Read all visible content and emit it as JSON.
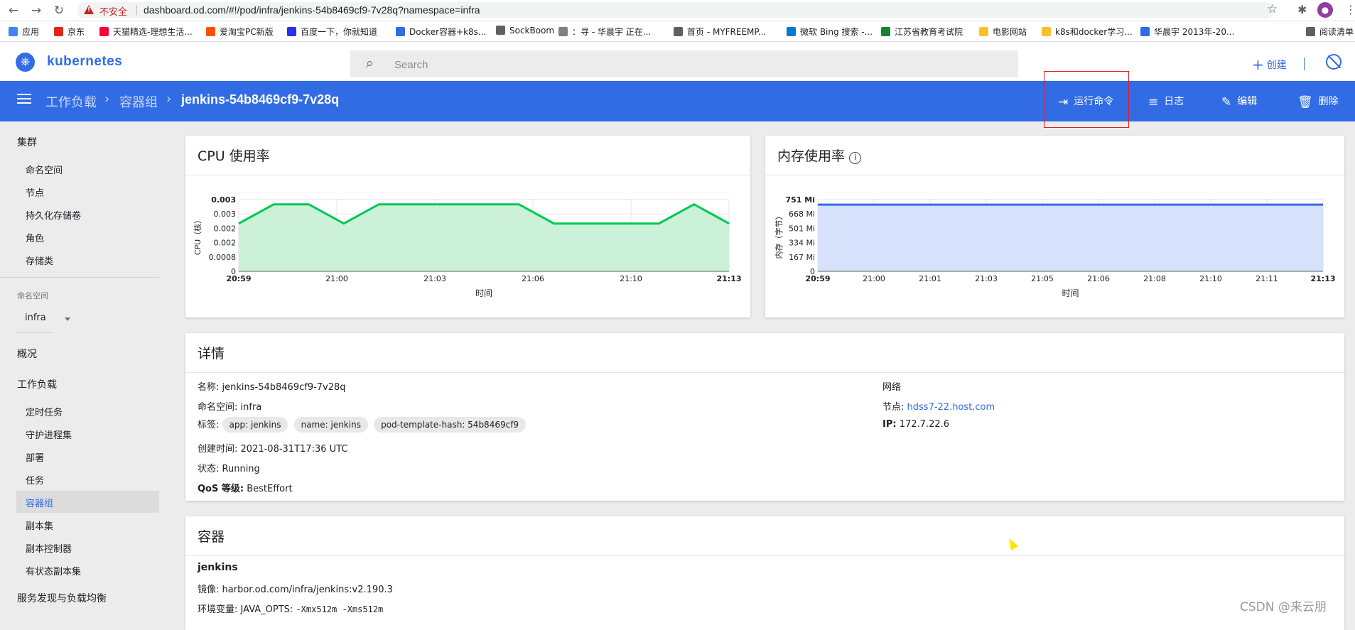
{
  "browser": {
    "insecure_label": "不安全",
    "url": "dashboard.od.com/#!/pod/infra/jenkins-54b8469cf9-7v28q?namespace=infra",
    "bookmarks": [
      "应用",
      "京东",
      "天猫精选-理想生活...",
      "爱淘宝PC新版",
      "百度一下，你就知道",
      "Docker容器+k8s...",
      "SockBoom",
      "：寻 - 华晨宇 正在...",
      "首页 - MYFREEMP...",
      "微软 Bing 搜索 -...",
      "江苏省教育考试院",
      "电影网站",
      "k8s和docker学习...",
      "华晨宇 2013年-20...",
      "阅读清单"
    ],
    "bookmark_colors": [
      "#4285f4",
      "#e1251b",
      "#ff0036",
      "#ff5000",
      "#2932e1",
      "#326ce5",
      "#606060",
      "#808080",
      "#606060",
      "#0078d4",
      "#1a7f37",
      "#fbc02d",
      "#fbc02d",
      "#326ce5",
      "#606060"
    ]
  },
  "header": {
    "brand": "kubernetes",
    "search_placeholder": "Search",
    "create_label": "创建"
  },
  "toolbar": {
    "breadcrumb": [
      "工作负载",
      "容器组"
    ],
    "current": "jenkins-54b8469cf9-7v28q",
    "actions": [
      "运行命令",
      "日志",
      "编辑",
      "删除"
    ]
  },
  "sidebar": {
    "cluster_heading": "集群",
    "cluster_items": [
      "命名空间",
      "节点",
      "持久化存储卷",
      "角色",
      "存储类"
    ],
    "namespace_label": "命名空间",
    "namespace_value": "infra",
    "overview": "概况",
    "workloads_heading": "工作负载",
    "workload_items": [
      "定时任务",
      "守护进程集",
      "部署",
      "任务",
      "容器组",
      "副本集",
      "副本控制器",
      "有状态副本集"
    ],
    "selected_item": "容器组",
    "services_heading": "服务发现与负载均衡"
  },
  "cpu_card": {
    "title": "CPU 使用率"
  },
  "memory_card": {
    "title": "内存使用率"
  },
  "chart_data": [
    {
      "type": "area",
      "title": "CPU 使用率",
      "xlabel": "时间",
      "ylabel": "CPU（核）",
      "x_ticks": [
        "20:59",
        "21:00",
        "21:03",
        "21:06",
        "21:10",
        "21:13"
      ],
      "y_ticks": [
        "0",
        "0.0008",
        "0.002",
        "0.002",
        "0.003",
        "0.003"
      ],
      "x": [
        "20:59",
        "21:00",
        "21:01",
        "21:02",
        "21:03",
        "21:04",
        "21:05",
        "21:06",
        "21:07",
        "21:08",
        "21:09",
        "21:10",
        "21:11",
        "21:12",
        "21:13"
      ],
      "values": [
        0.002,
        0.0028,
        0.0028,
        0.002,
        0.0028,
        0.0028,
        0.0028,
        0.0028,
        0.0028,
        0.002,
        0.002,
        0.002,
        0.002,
        0.0028,
        0.002
      ],
      "ylim": [
        0,
        0.003
      ],
      "color": "#00c752",
      "fill": "#cbf2d8",
      "grid": true
    },
    {
      "type": "area",
      "title": "内存使用率",
      "xlabel": "时间",
      "ylabel": "内存（字节）",
      "x_ticks": [
        "20:59",
        "21:00",
        "21:01",
        "21:03",
        "21:05",
        "21:06",
        "21:08",
        "21:10",
        "21:11",
        "21:13"
      ],
      "y_ticks": [
        "0",
        "167 Mi",
        "334 Mi",
        "501 Mi",
        "668 Mi",
        "751 Mi"
      ],
      "x": [
        "20:59",
        "21:13"
      ],
      "values": [
        698,
        698
      ],
      "ylim": [
        0,
        751
      ],
      "color": "#326ce5",
      "fill": "#d6e2fb",
      "grid": true
    }
  ],
  "details": {
    "title": "详情",
    "name_label": "名称:",
    "name": "jenkins-54b8469cf9-7v28q",
    "namespace_label": "命名空间:",
    "namespace": "infra",
    "labels_label": "标签:",
    "labels": [
      "app: jenkins",
      "name: jenkins",
      "pod-template-hash: 54b8469cf9"
    ],
    "created_label": "创建时间:",
    "created": "2021-08-31T17:36 UTC",
    "status_label": "状态:",
    "status": "Running",
    "qos_label": "QoS 等级:",
    "qos": "BestEffort",
    "network_heading": "网络",
    "node_label": "节点:",
    "node": "hdss7-22.host.com",
    "ip_label": "IP:",
    "ip": "172.7.22.6"
  },
  "containers": {
    "title": "容器",
    "name": "jenkins",
    "image_label": "镜像:",
    "image": "harbor.od.com/infra/jenkins:v2.190.3",
    "env_label": "环境变量:",
    "env_key": "JAVA_OPTS:",
    "env_value": "-Xmx512m -Xms512m"
  },
  "watermark": "CSDN @来云朋"
}
